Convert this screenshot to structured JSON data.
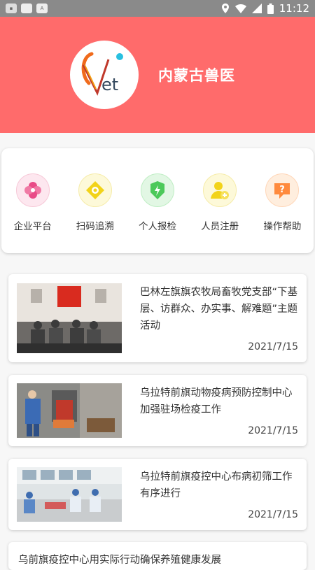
{
  "status_bar": {
    "time": "11:12"
  },
  "header": {
    "title": "内蒙古兽医",
    "logo_text": "Vet"
  },
  "menu": [
    {
      "label": "企业平台",
      "icon": "flower-icon",
      "color": "#e94b87"
    },
    {
      "label": "扫码追溯",
      "icon": "scan-icon",
      "color": "#f2d31a"
    },
    {
      "label": "个人报检",
      "icon": "shield-icon",
      "color": "#4cc95a"
    },
    {
      "label": "人员注册",
      "icon": "user-add-icon",
      "color": "#f2d31a"
    },
    {
      "label": "操作帮助",
      "icon": "help-icon",
      "color": "#ff8a3d"
    }
  ],
  "news": [
    {
      "title": "巴林左旗旗农牧局畜牧党支部“下基层、访群众、办实事、解难题”主题活动",
      "date": "2021/7/15"
    },
    {
      "title": "乌拉特前旗动物疫病预防控制中心加强驻场检疫工作",
      "date": "2021/7/15"
    },
    {
      "title": "乌拉特前旗疫控中心布病初筛工作有序进行",
      "date": "2021/7/15"
    },
    {
      "title": "乌前旗疫控中心用实际行动确保养殖健康发展"
    }
  ]
}
